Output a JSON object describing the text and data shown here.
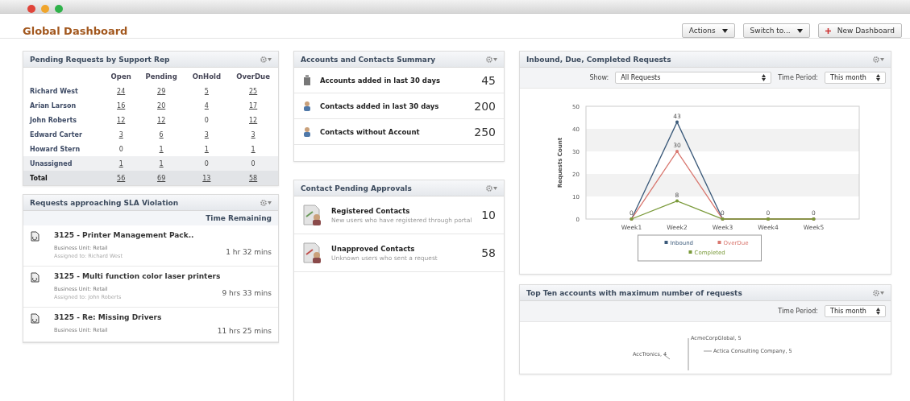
{
  "window": {
    "controls": [
      {
        "color": "#e0443a"
      },
      {
        "color": "#f0a52c"
      },
      {
        "color": "#2fb24a"
      }
    ]
  },
  "page_title": "Global Dashboard",
  "toolbar": [
    {
      "label": "Actions",
      "dropdown": true
    },
    {
      "label": "Switch to...",
      "dropdown": true
    },
    {
      "label": "New Dashboard",
      "dropdown": false
    }
  ],
  "pending_requests": {
    "title": "Pending Requests by Support Rep",
    "columns": [
      "Open",
      "Pending",
      "OnHold",
      "OverDue"
    ],
    "rows": [
      {
        "name": "Richard West",
        "kind": "rep",
        "values": [
          "24",
          "29",
          "5",
          "25"
        ]
      },
      {
        "name": "Arian Larson",
        "kind": "rep",
        "values": [
          "16",
          "20",
          "4",
          "17"
        ]
      },
      {
        "name": "John Roberts",
        "kind": "rep",
        "values": [
          "12",
          "12",
          "0",
          "12"
        ]
      },
      {
        "name": "Edward Carter",
        "kind": "rep",
        "values": [
          "3",
          "6",
          "3",
          "3"
        ]
      },
      {
        "name": "Howard Stern",
        "kind": "rep",
        "values": [
          "0",
          "1",
          "1",
          "1"
        ]
      },
      {
        "name": "Unassigned",
        "kind": "unassigned",
        "values": [
          "1",
          "1",
          "0",
          "0"
        ]
      },
      {
        "name": "Total",
        "kind": "total",
        "values": [
          "56",
          "69",
          "13",
          "58"
        ]
      }
    ]
  },
  "sla": {
    "title": "Requests approaching SLA Violation",
    "column": "Time Remaining",
    "items": [
      {
        "title": "3125 - Printer Management Pack..",
        "unit": "Business Unit: Retail",
        "assigned": "Assigned to: Richard West",
        "remaining": "1 hr 32 mins"
      },
      {
        "title": "3125 - Multi function color laser printers",
        "unit": "Business Unit: Retail",
        "assigned": "Assigned to: John Roberts",
        "remaining": "9 hrs 33 mins"
      },
      {
        "title": "3125 - Re: Missing Drivers",
        "unit": "Business Unit: Retail",
        "remaining": "11 hrs 25 mins"
      }
    ]
  },
  "summary": {
    "title": "Accounts and Contacts Summary",
    "items": [
      {
        "kind": "account",
        "label": "Accounts added in last 30 days",
        "count": "45"
      },
      {
        "kind": "contact",
        "label": "Contacts added in last 30 days",
        "count": "200"
      },
      {
        "kind": "contact",
        "label": "Contacts without Account",
        "count": "250"
      }
    ]
  },
  "approvals": {
    "title": "Contact Pending Approvals",
    "items": [
      {
        "kind": "registered",
        "label": "Registered Contacts",
        "description": "New users who have registered through portal",
        "count": "10"
      },
      {
        "kind": "unapproved",
        "label": "Unapproved Contacts",
        "description": "Unknown users who sent a request",
        "count": "58"
      }
    ]
  },
  "requests_chart": {
    "title": "Inbound, Due, Completed Requests",
    "show_label": "Show:",
    "show_value": "All Requests",
    "period_label": "Time Period:",
    "period_value": "This month",
    "chart_data": {
      "type": "line",
      "ylabel": "Requests Count",
      "categories": [
        "Week1",
        "Week2",
        "Week3",
        "Week4",
        "Week5"
      ],
      "legend": "bottom",
      "ylim": [
        0,
        50
      ],
      "yticks": [
        0,
        10,
        20,
        30,
        40,
        50
      ],
      "series": [
        {
          "name": "Inbound",
          "color": "#3b5a7a",
          "values": [
            0,
            43,
            0,
            0,
            0
          ],
          "value_labels": [
            "0",
            "43",
            "0",
            "0",
            "0"
          ]
        },
        {
          "name": "OverDue",
          "color": "#d9776f",
          "values": [
            0,
            30,
            0,
            0,
            0
          ],
          "value_labels": [
            null,
            "30",
            null,
            null,
            null
          ]
        },
        {
          "name": "Completed",
          "color": "#7a9a3a",
          "values": [
            0,
            8,
            0,
            0,
            0
          ],
          "value_labels": [
            null,
            "8",
            null,
            null,
            null
          ]
        }
      ]
    }
  },
  "top_accounts": {
    "title": "Top Ten accounts with maximum number of requests",
    "period_label": "Time Period:",
    "period_value": "This month",
    "labels": [
      "AccTronics, 4",
      "AcmeCorpGlobal, 5",
      "Actica Consulting Company, 5"
    ]
  }
}
